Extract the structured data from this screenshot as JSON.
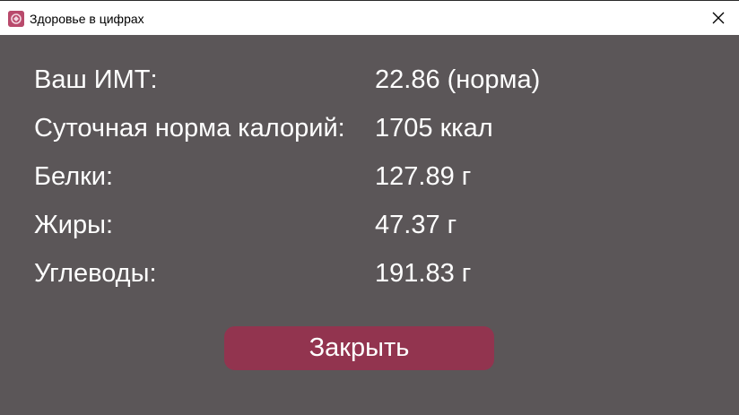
{
  "window": {
    "title": "Здоровье в цифрах",
    "app_icon": "app-logo-icon",
    "close_icon": "close-icon"
  },
  "results": [
    {
      "label": "Ваш ИМТ:",
      "value": "22.86 (норма)"
    },
    {
      "label": "Суточная норма калорий:",
      "value": "1705 ккал"
    },
    {
      "label": "Белки:",
      "value": "127.89 г"
    },
    {
      "label": "Жиры:",
      "value": "47.37 г"
    },
    {
      "label": "Углеводы:",
      "value": "191.83 г"
    }
  ],
  "actions": {
    "close_label": "Закрыть"
  },
  "colors": {
    "background": "#5b5658",
    "accent": "#92344f",
    "text": "#ffffff",
    "titlebar": "#ffffff"
  }
}
